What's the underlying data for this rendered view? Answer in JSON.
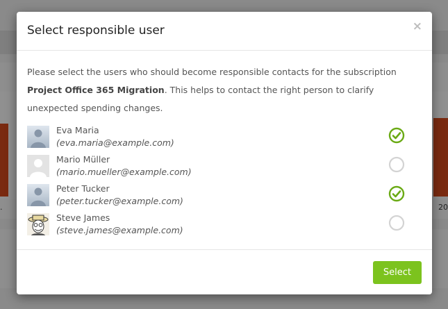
{
  "modal": {
    "title": "Select responsible user",
    "close_label": "×",
    "description_prefix": "Please select the users who should become responsible contacts for the subscription ",
    "subscription_name": "Project Office 365 Migration",
    "description_suffix": ". This helps to contact the right person to clarify unexpected spending changes.",
    "select_label": "Select"
  },
  "users": [
    {
      "name": "Eva Maria",
      "email": "(eva.maria@example.com)",
      "avatar": "default-person-avatar",
      "selected": true
    },
    {
      "name": "Mario Müller",
      "email": "(mario.mueller@example.com)",
      "avatar": "blank-silhouette-avatar",
      "selected": false
    },
    {
      "name": "Peter Tucker",
      "email": "(peter.tucker@example.com)",
      "avatar": "default-person-avatar",
      "selected": true
    },
    {
      "name": "Steve James",
      "email": "(steve.james@example.com)",
      "avatar": "cartoon-face-avatar",
      "selected": false
    }
  ],
  "background": {
    "label_left": ".",
    "label_right": "20"
  },
  "colors": {
    "accent": "#7cc31e",
    "check_selected": "#6aaa14",
    "check_unselected": "#d3d3d3",
    "bar": "#c0471a"
  }
}
